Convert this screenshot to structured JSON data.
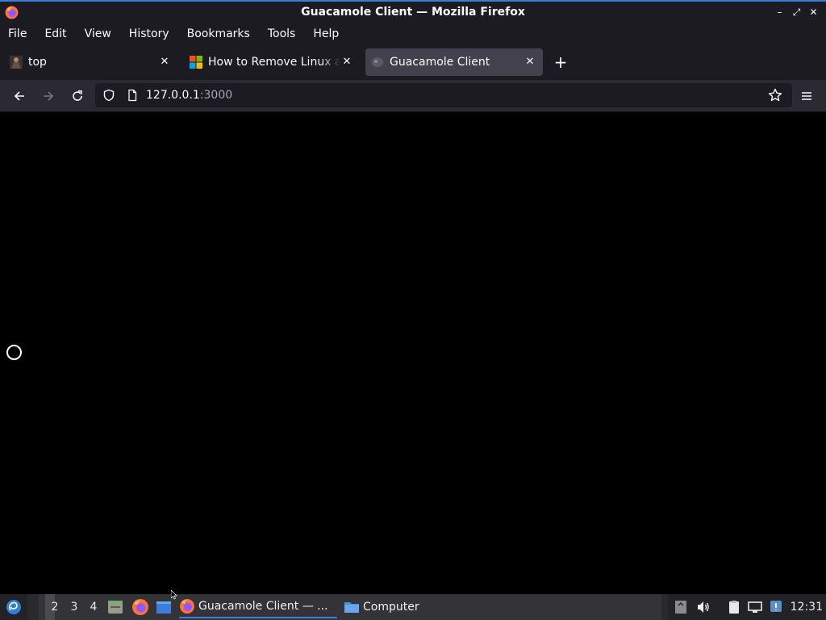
{
  "window": {
    "title": "Guacamole Client — Mozilla Firefox"
  },
  "menubar": {
    "items": [
      {
        "label": "File"
      },
      {
        "label": "Edit"
      },
      {
        "label": "View"
      },
      {
        "label": "History"
      },
      {
        "label": "Bookmarks"
      },
      {
        "label": "Tools"
      },
      {
        "label": "Help"
      }
    ]
  },
  "tabs": [
    {
      "label": "top",
      "active": false,
      "favicon": "user-avatar-icon"
    },
    {
      "label": "How to Remove Linux and",
      "active": false,
      "favicon": "microsoft-logo-icon"
    },
    {
      "label": "Guacamole Client",
      "active": true,
      "favicon": "guacamole-icon"
    }
  ],
  "navbar": {
    "url_host": "127.0.0.1",
    "url_port": ":3000"
  },
  "taskbar": {
    "workspaces": [
      "",
      "2",
      "3",
      "4"
    ],
    "tasks": [
      {
        "label": "Guacamole Client — ...",
        "icon": "firefox-icon",
        "active": true
      },
      {
        "label": "Computer",
        "icon": "folder-icon",
        "active": false
      }
    ],
    "clock": "12:31"
  },
  "colors": {
    "accent": "#3b7dd8",
    "chrome_dark": "#1c1b22",
    "toolbar": "#2b2a33",
    "active_tab": "#42414d"
  }
}
